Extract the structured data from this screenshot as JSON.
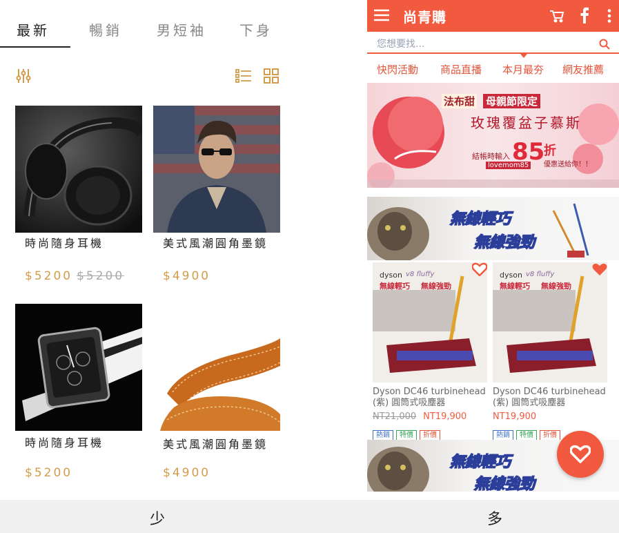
{
  "left": {
    "tabs": [
      "最新",
      "暢銷",
      "男短袖",
      "下身"
    ],
    "products": [
      {
        "name": "時尚隨身耳機",
        "price": "$5200",
        "old_price": "$5200"
      },
      {
        "name": "美式風潮圓角墨鏡",
        "price": "$4900"
      },
      {
        "name": "時尚隨身耳機",
        "price": "$5200"
      },
      {
        "name": "美式風潮圓角墨鏡",
        "price": "$4900"
      }
    ],
    "icons": {
      "filter": "filter-sliders-icon",
      "list": "list-view-icon",
      "grid": "grid-view-icon"
    },
    "accent": "#d49b4a"
  },
  "right": {
    "brand": "尚青購",
    "search_placeholder": "您想要找...",
    "quick_links": [
      "快閃活動",
      "商品直播",
      "本月最夯",
      "網友推薦"
    ],
    "banner_mother": {
      "brand_tag": "法布甜",
      "event_tag": "母親節限定",
      "headline": "玫瑰覆盆子慕斯",
      "code_label": "結帳時輸入",
      "discount": "85",
      "discount_unit": "折",
      "promo_code": "lovemom85",
      "note": "優惠送給你！！"
    },
    "banner_dyson": {
      "line1": "無線輕巧",
      "line2": "無線強勁"
    },
    "products": [
      {
        "brand": "dyson",
        "model": "v8 fluffy",
        "line1": "無線輕巧",
        "line2": "無線強勁",
        "title": "Dyson DC46 turbinehead (紫) 圓筒式吸塵器",
        "old_price": "NT21,000",
        "price": "NT19,900",
        "badges": [
          "熱銷",
          "特價",
          "折價"
        ]
      },
      {
        "brand": "dyson",
        "model": "v8 fluffy",
        "line1": "無線輕巧",
        "line2": "無線強勁",
        "title": "Dyson DC46 turbinehead (紫) 圓筒式吸塵器",
        "price": "NT19,900",
        "badges": [
          "熱銷",
          "特價",
          "折價"
        ]
      }
    ],
    "badge_colors": [
      "#3a6fc4",
      "#3aa65a",
      "#e0553a"
    ],
    "theme_color": "#f25a3f"
  },
  "bottom": {
    "left_label": "少",
    "right_label": "多"
  }
}
